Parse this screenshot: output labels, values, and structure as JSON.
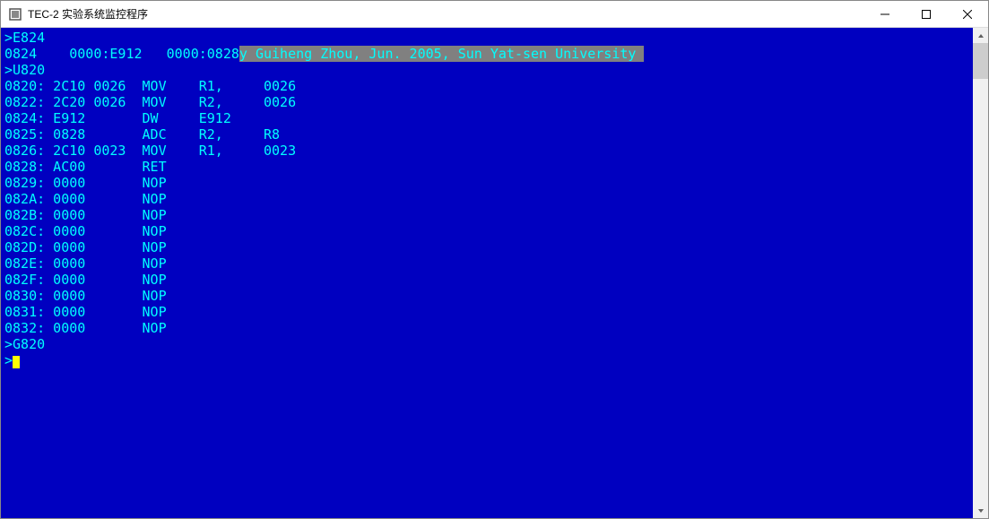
{
  "window": {
    "title": "TEC-2 实验系统监控程序"
  },
  "terminal": {
    "lines": [
      {
        "prompt": ">",
        "text": "E824",
        "highlighted": ""
      },
      {
        "prompt": "",
        "text": "0824    0000:E912   0000:0828",
        "highlighted": "y Guiheng Zhou, Jun. 2005, Sun Yat-sen University "
      },
      {
        "prompt": ">",
        "text": "U820",
        "highlighted": ""
      },
      {
        "prompt": "",
        "text": "0820: 2C10 0026  MOV    R1,     0026",
        "highlighted": ""
      },
      {
        "prompt": "",
        "text": "0822: 2C20 0026  MOV    R2,     0026",
        "highlighted": ""
      },
      {
        "prompt": "",
        "text": "0824: E912       DW     E912",
        "highlighted": ""
      },
      {
        "prompt": "",
        "text": "0825: 0828       ADC    R2,     R8",
        "highlighted": ""
      },
      {
        "prompt": "",
        "text": "0826: 2C10 0023  MOV    R1,     0023",
        "highlighted": ""
      },
      {
        "prompt": "",
        "text": "0828: AC00       RET",
        "highlighted": ""
      },
      {
        "prompt": "",
        "text": "0829: 0000       NOP",
        "highlighted": ""
      },
      {
        "prompt": "",
        "text": "082A: 0000       NOP",
        "highlighted": ""
      },
      {
        "prompt": "",
        "text": "082B: 0000       NOP",
        "highlighted": ""
      },
      {
        "prompt": "",
        "text": "082C: 0000       NOP",
        "highlighted": ""
      },
      {
        "prompt": "",
        "text": "082D: 0000       NOP",
        "highlighted": ""
      },
      {
        "prompt": "",
        "text": "082E: 0000       NOP",
        "highlighted": ""
      },
      {
        "prompt": "",
        "text": "082F: 0000       NOP",
        "highlighted": ""
      },
      {
        "prompt": "",
        "text": "0830: 0000       NOP",
        "highlighted": ""
      },
      {
        "prompt": "",
        "text": "0831: 0000       NOP",
        "highlighted": ""
      },
      {
        "prompt": "",
        "text": "0832: 0000       NOP",
        "highlighted": ""
      },
      {
        "prompt": ">",
        "text": "G820",
        "highlighted": ""
      },
      {
        "prompt": ">",
        "text": "",
        "highlighted": "",
        "cursor": true
      }
    ]
  }
}
